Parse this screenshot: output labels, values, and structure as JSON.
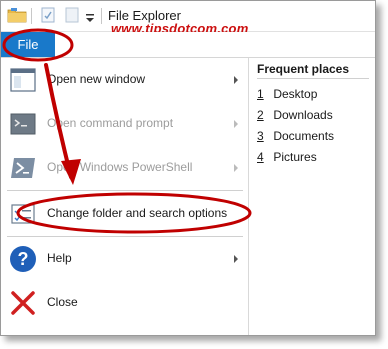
{
  "window": {
    "title": "File Explorer"
  },
  "watermark": "www.tipsdotcom.com",
  "ribbon": {
    "file_tab": "File"
  },
  "menu": {
    "items": [
      {
        "label": "Open new window",
        "enabled": true,
        "has_submenu": true,
        "icon": "new-window-icon"
      },
      {
        "label": "Open command prompt",
        "enabled": false,
        "has_submenu": true,
        "icon": "command-prompt-icon"
      },
      {
        "label": "Open Windows PowerShell",
        "enabled": false,
        "has_submenu": true,
        "icon": "powershell-icon"
      },
      {
        "label": "Change folder and search options",
        "enabled": true,
        "has_submenu": false,
        "icon": "folder-options-icon"
      },
      {
        "label": "Help",
        "enabled": true,
        "has_submenu": true,
        "icon": "help-icon"
      },
      {
        "label": "Close",
        "enabled": true,
        "has_submenu": false,
        "icon": "close-icon"
      }
    ]
  },
  "frequent_places": {
    "header": "Frequent places",
    "items": [
      {
        "num": "1",
        "label": "Desktop"
      },
      {
        "num": "2",
        "label": "Downloads"
      },
      {
        "num": "3",
        "label": "Documents"
      },
      {
        "num": "4",
        "label": "Pictures"
      }
    ]
  },
  "colors": {
    "file_tab": "#1979ca",
    "annotation": "#c00000",
    "watermark": "#cc1010"
  }
}
